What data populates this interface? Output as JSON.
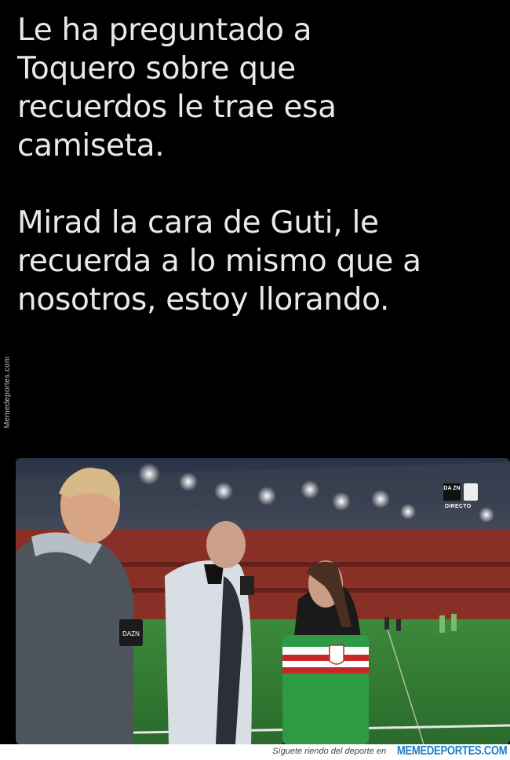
{
  "tweet": {
    "paragraph1_lines": [
      "Le ha preguntado a",
      "Toquero sobre que",
      "recuerdos le trae esa",
      "camiseta."
    ],
    "paragraph2_lines": [
      "Mirad la cara de Guti, le",
      "recuerda a lo mismo que a",
      "nosotros, estoy llorando."
    ]
  },
  "watermark": {
    "side_text": "Memedeportes.com"
  },
  "video": {
    "badge_logo_text": "DA ZN",
    "badge_status": "DIRECTO",
    "mic_flag_text": "DA ZN"
  },
  "footer": {
    "tagline": "Síguete riendo del deporte en",
    "brand": "MEMEDEPORTES.COM"
  },
  "colors": {
    "background": "#000000",
    "text": "#e8e8e8",
    "pitch": "#2f7a34",
    "stands": "#7a2a22",
    "brand_blue": "#1b7ecb"
  }
}
